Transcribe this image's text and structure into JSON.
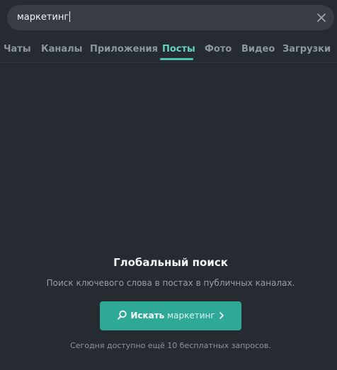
{
  "search": {
    "value": "маркетинг"
  },
  "tabs": [
    {
      "label": "Чаты",
      "active": false
    },
    {
      "label": "Каналы",
      "active": false
    },
    {
      "label": "Приложения",
      "active": false
    },
    {
      "label": "Посты",
      "active": true
    },
    {
      "label": "Фото",
      "active": false
    },
    {
      "label": "Видео",
      "active": false
    },
    {
      "label": "Загрузки",
      "active": false
    }
  ],
  "empty_state": {
    "title": "Глобальный поиск",
    "subtitle": "Поиск ключевого слова в постах в публичных каналах.",
    "button_prefix": "Искать",
    "button_query": "маркетинг",
    "note": "Сегодня доступно ещё 10 бесплатных запросов."
  },
  "icons": {
    "clear": "close-icon",
    "search": "search-icon",
    "chevron": "chevron-right-icon"
  },
  "colors": {
    "accent": "#4fc3b3",
    "button": "#2ea897",
    "background": "#262b31"
  }
}
